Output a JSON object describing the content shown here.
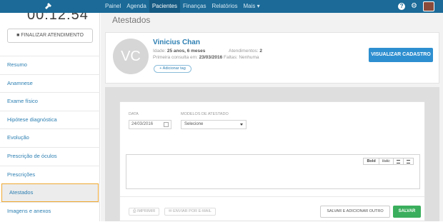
{
  "topbar": {
    "nav": [
      "Painel",
      "Agenda",
      "Pacientes",
      "Finanças",
      "Relatórios",
      "Mais ▾"
    ],
    "active_nav": "Pacientes"
  },
  "sidebar": {
    "timer": "00:12:54",
    "finalize_label": "■ FINALIZAR ATENDIMENTO",
    "items": [
      {
        "label": "Resumo"
      },
      {
        "label": "Anamnese"
      },
      {
        "label": "Exame físico"
      },
      {
        "label": "Hipótese diagnóstica"
      },
      {
        "label": "Evolução"
      },
      {
        "label": "Prescrição de óculos"
      },
      {
        "label": "Prescrições"
      },
      {
        "label": "Atestados"
      },
      {
        "label": "Imagens e anexos"
      }
    ],
    "active_item": "Atestados"
  },
  "main": {
    "title": "Atestados",
    "patient": {
      "initials": "VC",
      "name": "Vinicius Chan",
      "age_label": "Idade:",
      "age_value": "25 anos, 6 meses",
      "first_visit_label": "Primeira consulta em:",
      "first_visit_value": "23/03/2016",
      "appointments_label": "Atendimentos:",
      "appointments_value": "2",
      "faults_label": "Faltas:",
      "faults_value": "Nenhuma",
      "tag_button": "+ Adicionar tag",
      "view_button": "VISUALIZAR CADASTRO"
    },
    "form": {
      "date_label": "DATA",
      "date_value": "24/03/2016",
      "model_label": "MODELOS DE ATESTADO",
      "model_value": "Selecione",
      "toolbar": {
        "bold": "Bold",
        "italic": "Italic"
      },
      "print_label": "IMPRIMIR",
      "email_label": "ENVIAR POR E-MAIL",
      "save_other_label": "SALVAR E ADICIONAR OUTRO",
      "save_label": "SALVAR"
    }
  }
}
